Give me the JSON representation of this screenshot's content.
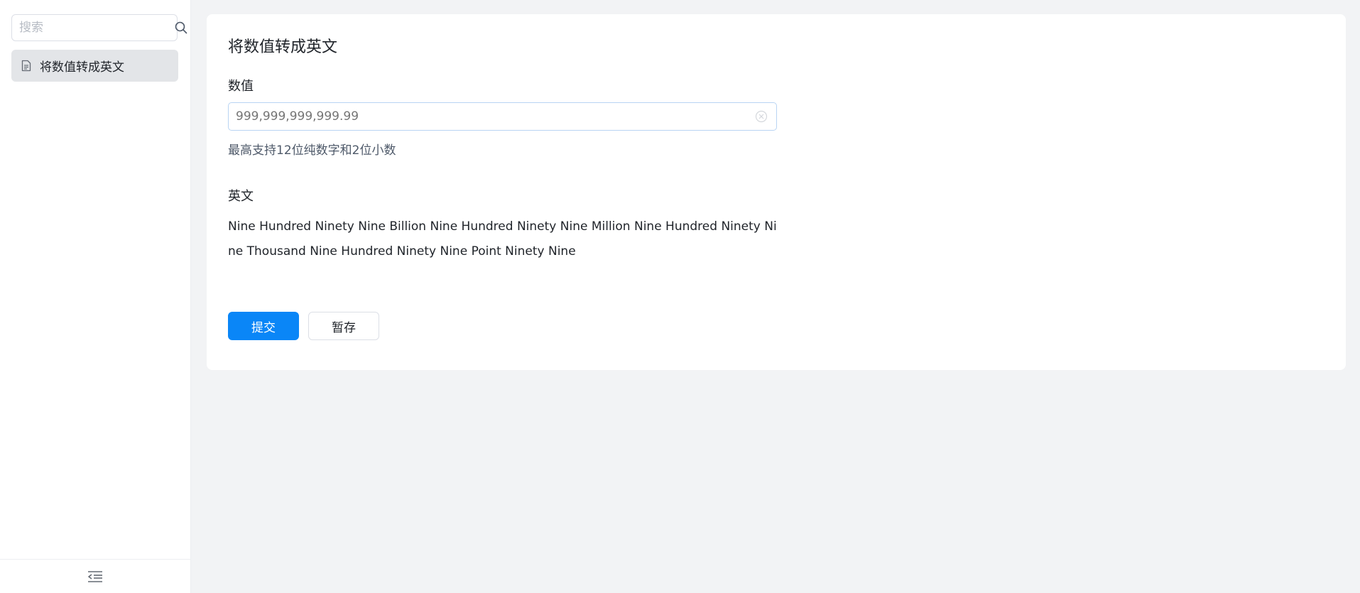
{
  "sidebar": {
    "search": {
      "placeholder": "搜索",
      "value": ""
    },
    "items": [
      {
        "label": "将数值转成英文",
        "icon": "document-icon",
        "active": true
      }
    ],
    "footer_icon": "collapse-sidebar-icon"
  },
  "main": {
    "title": "将数值转成英文",
    "number_field": {
      "label": "数值",
      "value": "",
      "placeholder": "999,999,999,999.99",
      "hint": "最高支持12位纯数字和2位小数"
    },
    "english_field": {
      "label": "英文",
      "result": "Nine Hundred Ninety Nine Billion Nine Hundred Ninety Nine Million Nine Hundred Ninety Nine Thousand Nine Hundred Ninety Nine Point Ninety Nine"
    },
    "actions": {
      "submit_label": "提交",
      "save_label": "暂存"
    }
  },
  "colors": {
    "page_background": "#f2f3f5",
    "primary": "#0a86f7",
    "active_item_background": "#e3e5e8"
  }
}
